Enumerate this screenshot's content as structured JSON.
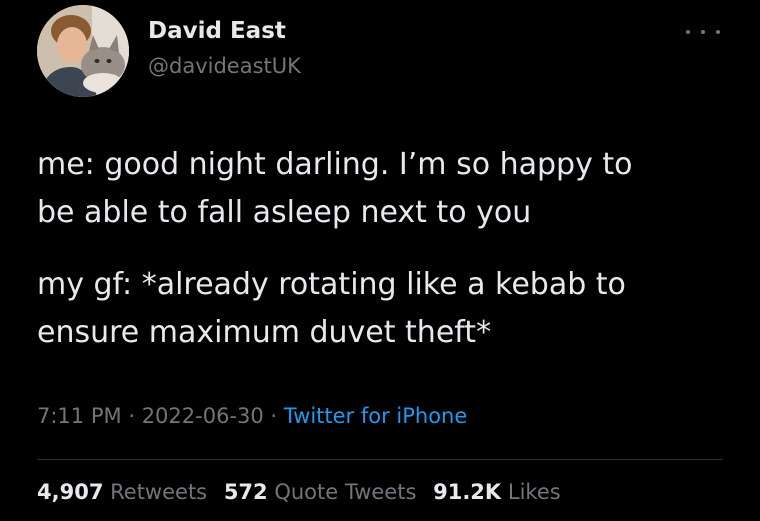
{
  "author": {
    "name": "David East",
    "handle": "@davideastUK",
    "avatar_icon": "profile-photo-with-cat"
  },
  "tweet": {
    "paragraphs": [
      [
        "me: good night darling. I’m so happy to",
        "be able to fall asleep next to you"
      ],
      [
        "my gf: *already rotating like a kebab to",
        "ensure maximum duvet theft*"
      ]
    ],
    "time": "7:11 PM",
    "date": "2022-06-30",
    "separator": "·",
    "source": "Twitter for iPhone"
  },
  "stats": {
    "retweets": {
      "count": "4,907",
      "label": "Retweets"
    },
    "quote_tweets": {
      "count": "572",
      "label": "Quote Tweets"
    },
    "likes": {
      "count": "91.2K",
      "label": "Likes"
    }
  },
  "colors": {
    "background": "#000000",
    "text": "#e7e9ea",
    "muted": "#71767b",
    "link": "#1d9bf0",
    "divider": "#2f3336"
  }
}
